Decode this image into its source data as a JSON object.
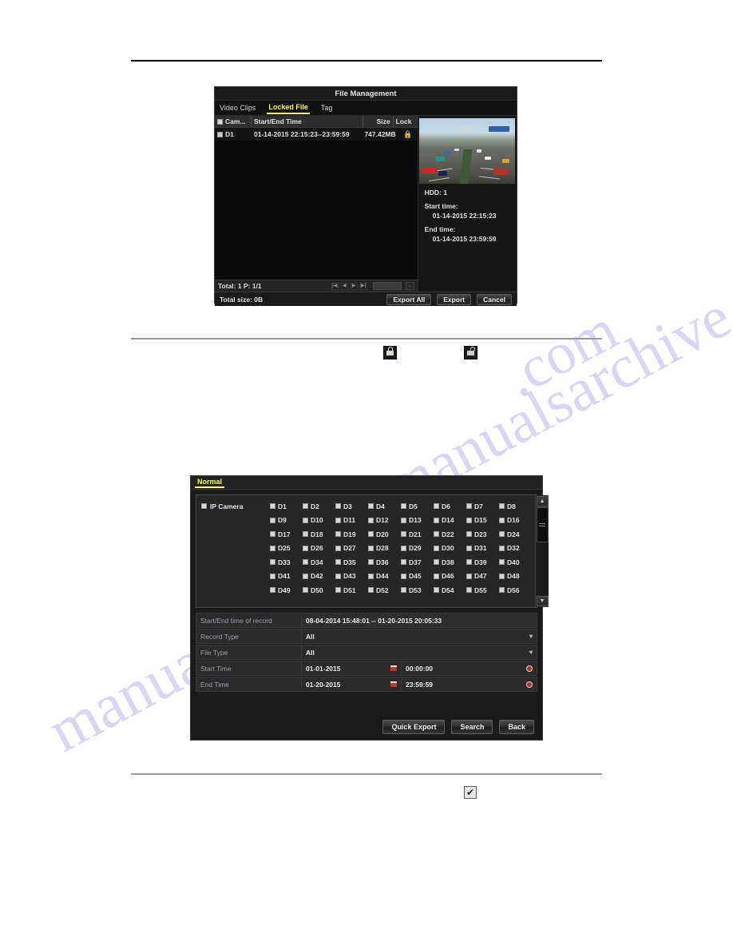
{
  "watermark": {
    "line1": "manualsarchive",
    "line2": "manualsarchive",
    "line3": ".com"
  },
  "file_management": {
    "title": "File Management",
    "tabs": [
      {
        "label": "Video Clips",
        "active": false
      },
      {
        "label": "Locked File",
        "active": true
      },
      {
        "label": "Tag",
        "active": false
      }
    ],
    "columns": [
      "Cam...",
      "Start/End Time",
      "Size",
      "Lock"
    ],
    "rows": [
      {
        "camera": "D1",
        "time": "01-14-2015 22:15:23--23:59:59",
        "size": "747.42MB",
        "lock_icon": "lock-closed-icon"
      }
    ],
    "pagination": {
      "total_label": "Total: 1  P: 1/1",
      "first": "|◀",
      "prev": "◀",
      "next": "▶",
      "last": "▶|",
      "page_input_value": "",
      "go_label": "→"
    },
    "details": {
      "hdd_label": "HDD: 1",
      "start_time_label": "Start time:",
      "start_time_value": "01-14-2015 22:15:23",
      "end_time_label": "End time:",
      "end_time_value": "01-14-2015 23:59:59"
    },
    "footer": {
      "total_size": "Total size: 0B",
      "export_all": "Export All",
      "export": "Export",
      "cancel": "Cancel"
    },
    "preview_alt": "highway-traffic-preview"
  },
  "standalone_icons": {
    "lock_closed": "lock-closed-icon",
    "lock_open": "lock-open-icon",
    "checkbox_checked": "✔"
  },
  "search_panel": {
    "tab": "Normal",
    "ip_camera_label": "IP Camera",
    "ip_camera_checked": true,
    "camera_rows": [
      [
        "D1",
        "D2",
        "D3",
        "D4",
        "D5",
        "D6",
        "D7",
        "D8"
      ],
      [
        "D9",
        "D10",
        "D11",
        "D12",
        "D13",
        "D14",
        "D15",
        "D16"
      ],
      [
        "D17",
        "D18",
        "D19",
        "D20",
        "D21",
        "D22",
        "D23",
        "D24"
      ],
      [
        "D25",
        "D26",
        "D27",
        "D28",
        "D29",
        "D30",
        "D31",
        "D32"
      ],
      [
        "D33",
        "D34",
        "D35",
        "D36",
        "D37",
        "D38",
        "D39",
        "D40"
      ],
      [
        "D41",
        "D42",
        "D43",
        "D44",
        "D45",
        "D46",
        "D47",
        "D48"
      ],
      [
        "D49",
        "D50",
        "D51",
        "D52",
        "D53",
        "D54",
        "D55",
        "D56"
      ]
    ],
    "fields": {
      "record_range_label": "Start/End time of record",
      "record_range_value": "08-04-2014 15:48:01 -- 01-20-2015 20:05:33",
      "record_type_label": "Record Type",
      "record_type_value": "All",
      "file_type_label": "File Type",
      "file_type_value": "All",
      "start_time_label": "Start Time",
      "start_date_value": "01-01-2015",
      "start_clock_value": "00:00:00",
      "end_time_label": "End Time",
      "end_date_value": "01-20-2015",
      "end_clock_value": "23:59:59"
    },
    "buttons": {
      "quick_export": "Quick Export",
      "search": "Search",
      "back": "Back"
    }
  }
}
